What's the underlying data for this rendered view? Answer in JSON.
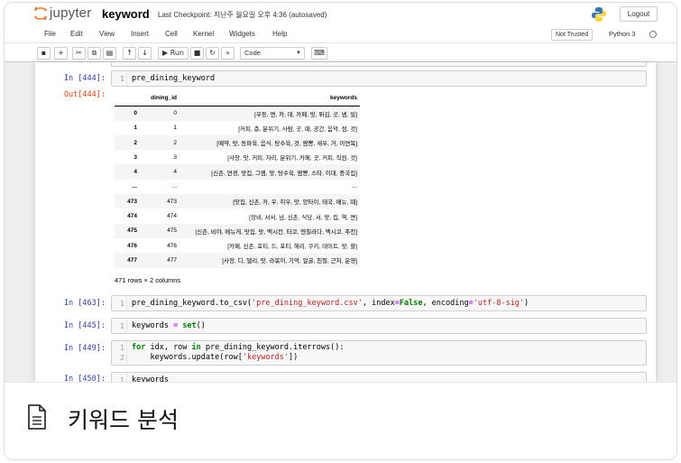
{
  "header": {
    "logo_text": "jupyter",
    "notebook_name": "keyword",
    "checkpoint": "Last Checkpoint: 지난주 월요일 오후 4:36  (autosaved)",
    "logout_label": "Logout"
  },
  "menu": {
    "items": [
      "File",
      "Edit",
      "View",
      "Insert",
      "Cell",
      "Kernel",
      "Widgets",
      "Help"
    ],
    "trusted": "Not Trusted",
    "kernel": "Python 3"
  },
  "toolbar": {
    "run_label": "▶ Run",
    "cell_type": "Code"
  },
  "cells": [
    {
      "prompt": "In [444]:",
      "lines": [
        "pre_dining_keyword"
      ]
    },
    {
      "prompt": "In [463]:",
      "lines": [
        "pre_dining_keyword.to_csv('pre_dining_keyword.csv', index=False, encoding='utf-8-sig')"
      ]
    },
    {
      "prompt": "In [445]:",
      "lines": [
        "keywords = set()"
      ]
    },
    {
      "prompt": "In [449]:",
      "lines": [
        "for idx, row in pre_dining_keyword.iterrows():",
        "    keywords.update(row['keywords'])"
      ]
    },
    {
      "prompt": "In [450]:",
      "lines": [
        "keywords"
      ]
    }
  ],
  "output": {
    "prompt": "Out[444]:",
    "columns": [
      "dining_id",
      "keywords"
    ],
    "rows": [
      {
        "index": "0",
        "dining_id": "0",
        "keywords": "[우동, 면, 카, 데, 카페, 맛, 튀김, 곳, 넴, 빌]"
      },
      {
        "index": "1",
        "dining_id": "1",
        "keywords": "[커피, 층, 분위기, 사람, 곳, 때, 공간, 음악, 점, 것]"
      },
      {
        "index": "2",
        "dining_id": "2",
        "keywords": "[예약, 맛, 동파육, 음식, 탕수육, 것, 짬뽕, 새우, 거, 이연복]"
      },
      {
        "index": "3",
        "dining_id": "3",
        "keywords": "[사장, 맛, 커피, 자리, 분위기, 카페, 곳, 커피, 직원, 것]"
      },
      {
        "index": "4",
        "dining_id": "4",
        "keywords": "[신촌, 연경, 맛집, 그램, 맛, 탕수육, 짬뽕, 스타, 이대, 중국집]"
      },
      {
        "index": "...",
        "dining_id": "...",
        "keywords": "..."
      },
      {
        "index": "473",
        "dining_id": "473",
        "keywords": "[맛집, 신촌, 카, 우, 히우, 맛, 양타이, 태국, 메뉴, 때]"
      },
      {
        "index": "474",
        "dining_id": "474",
        "keywords": "[장비, 서서, 넘, 신촌, 식당, 서, 맛, 집, 역, 면]"
      },
      {
        "index": "475",
        "dining_id": "475",
        "keywords": "[신촌, 비야, 메뉴게, 맛집, 맛, 멕시칸, 타코, 엔칠라다, 멕시코, 추천]"
      },
      {
        "index": "476",
        "dining_id": "476",
        "keywords": "[카페, 신촌, 포티, 드, 포티, 헤리, 쿠키, 데이트, 맛, 할]"
      },
      {
        "index": "477",
        "dining_id": "477",
        "keywords": "[사장, 디, 델리, 맛, 라볶이, 기억, 얼굴, 친절, 근처, 운영]"
      }
    ],
    "shape": "471 rows × 2 columns"
  },
  "caption": {
    "title": "키워드 분석"
  },
  "icons": [
    "jupyter-logo-icon",
    "python-logo-icon",
    "save-icon",
    "plus-icon",
    "scissors-icon",
    "copy-icon",
    "paste-icon",
    "arrow-up-icon",
    "arrow-down-icon",
    "stop-icon",
    "restart-icon",
    "fast-forward-icon",
    "keyboard-icon",
    "document-icon"
  ]
}
